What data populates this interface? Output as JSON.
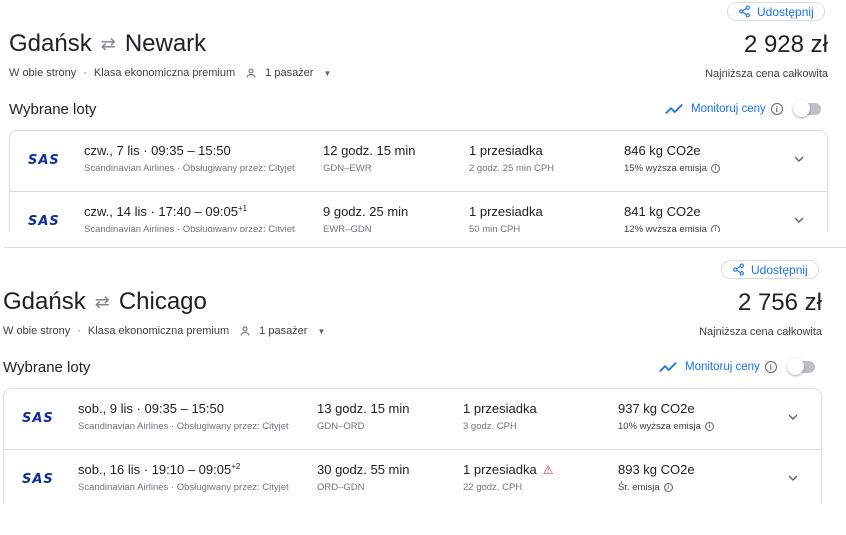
{
  "trips": [
    {
      "share_label": "Udostępnij",
      "origin": "Gdańsk",
      "destination": "Newark",
      "price": "2 928 zł",
      "trip_type": "W obie strony",
      "cabin": "Klasa ekonomiczna premium",
      "passengers": "1 pasażer",
      "price_note": "Najniższa cena całkowita",
      "section_title": "Wybrane loty",
      "monitor_label": "Monitoruj ceny",
      "flights": [
        {
          "airline_logo": "SAS",
          "date_time": "czw., 7 lis · 09:35 – 15:50",
          "day_offset": "",
          "airline": "Scandinavian Airlines · Obsługiwany przez: Cityjet",
          "duration": "12 godz. 15 min",
          "route": "GDN–EWR",
          "stops": "1 przesiadka",
          "warning": false,
          "layover": "2 godz. 25 min CPH",
          "co2": "846 kg CO2e",
          "emission": "15% wyższa emisja"
        },
        {
          "airline_logo": "SAS",
          "date_time": "czw., 14 lis · 17:40 – 09:05",
          "day_offset": "+1",
          "airline": "Scandinavian Airlines · Obsługiwany przez: Cityjet",
          "duration": "9 godz. 25 min",
          "route": "EWR–GDN",
          "stops": "1 przesiadka",
          "warning": false,
          "layover": "50 min CPH",
          "co2": "841 kg CO2e",
          "emission": "12% wyższa emisja"
        }
      ]
    },
    {
      "share_label": "Udostępnij",
      "origin": "Gdańsk",
      "destination": "Chicago",
      "price": "2 756 zł",
      "trip_type": "W obie strony",
      "cabin": "Klasa ekonomiczna premium",
      "passengers": "1 pasażer",
      "price_note": "Najniższa cena całkowita",
      "section_title": "Wybrane loty",
      "monitor_label": "Monitoruj ceny",
      "flights": [
        {
          "airline_logo": "SAS",
          "date_time": "sob., 9 lis · 09:35 – 15:50",
          "day_offset": "",
          "airline": "Scandinavian Airlines · Obsługiwany przez: Cityjet",
          "duration": "13 godz. 15 min",
          "route": "GDN–ORD",
          "stops": "1 przesiadka",
          "warning": false,
          "layover": "3 godz. CPH",
          "co2": "937 kg CO2e",
          "emission": "10% wyższa emisja"
        },
        {
          "airline_logo": "SAS",
          "date_time": "sob., 16 lis · 19:10 – 09:05",
          "day_offset": "+2",
          "airline": "Scandinavian Airlines · Obsługiwany przez: Cityjet",
          "duration": "30 godz. 55 min",
          "route": "ORD–GDN",
          "stops": "1 przesiadka",
          "warning": true,
          "layover": "22 godz. CPH",
          "co2": "893 kg CO2e",
          "emission": "Śr. emisja"
        }
      ]
    }
  ],
  "colors": {
    "accent": "#1a73e8",
    "brand_sas": "#0f2c9b",
    "warning": "#d93025"
  },
  "icons": [
    "share-icon",
    "swap-arrows-icon",
    "person-icon",
    "dropdown-caret-icon",
    "trend-chart-icon",
    "info-icon",
    "chevron-down-icon",
    "warning-icon"
  ]
}
